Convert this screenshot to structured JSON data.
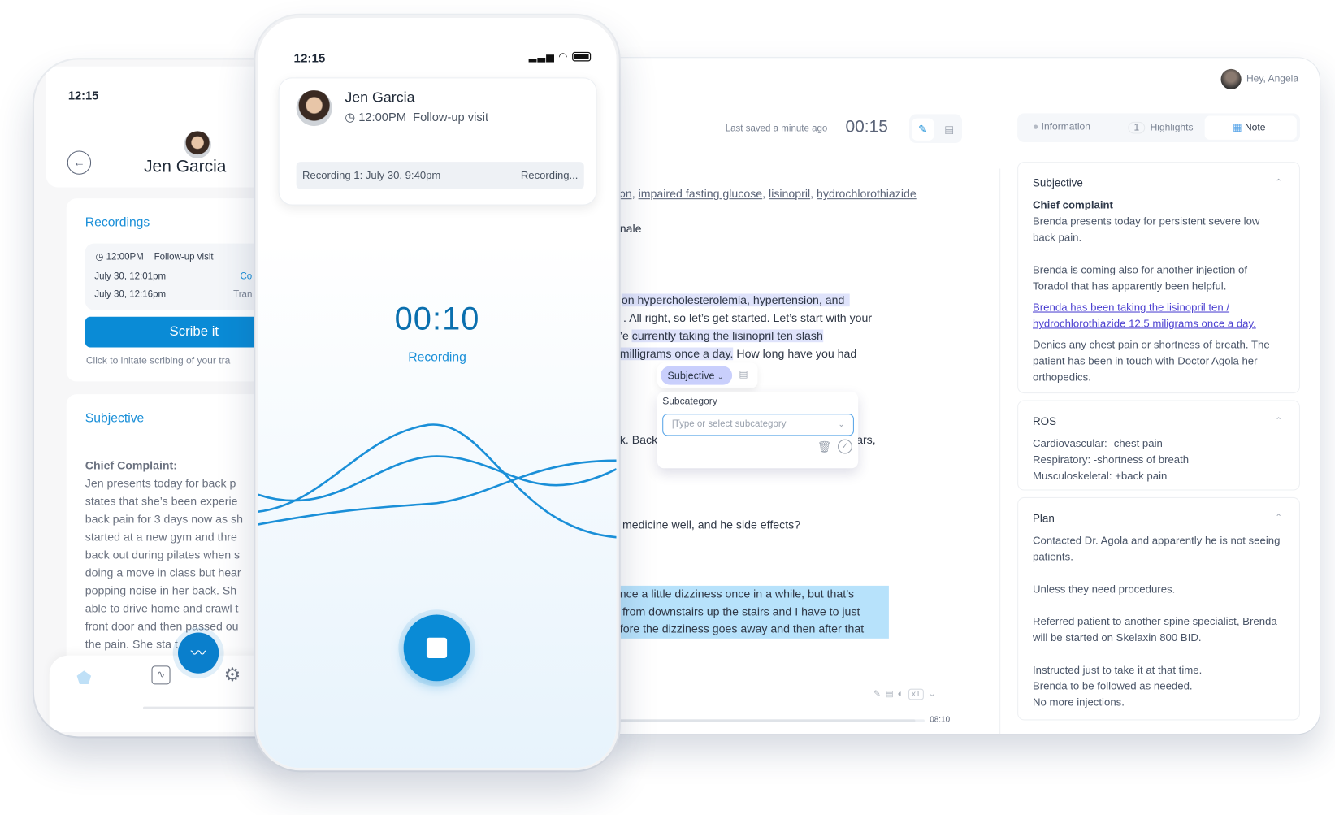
{
  "dashboard": {
    "user_greeting": "Hey, Angela",
    "last_saved": "Last saved a minute ago",
    "timer": "00:15",
    "tabs": [
      {
        "label": "Information",
        "icon": "info-icon"
      },
      {
        "count": "1",
        "label": "Highlights"
      },
      {
        "label": "Note",
        "icon": "note-icon",
        "active": true
      }
    ],
    "transcript": {
      "keywords": [
        "ɔn,",
        "impaired fasting glucose",
        "lisinopril",
        "hydrochlorothiazide"
      ],
      "line_nale": "nale",
      "l1": "on hypercholesterolemia, hypertension, and",
      "l2": ". All right, so let’s get started. Let’s start with your",
      "l3a": "’e ",
      "l3b": "currently taking the lisinopril ten slash",
      "l4a": "milligrams once a day.",
      "l4b": " How long have you had",
      "l5a": "k. Back",
      "l5b": "ars,",
      "l6": "medicine well, and he side effects?",
      "l7": "nce a little dizziness once in a while, but that’s",
      "l8": " from downstairs up the stairs and I have to just",
      "l9": "fore the dizziness goes away and then after that"
    },
    "tag_popup": {
      "category": "Subjective",
      "subcategory_label": "Subcategory",
      "subcategory_placeholder": "Type or select subcategory"
    },
    "player": {
      "speed": "x1",
      "time": "08:10",
      "progress": 0.97
    },
    "note": {
      "subjective": {
        "title": "Subjective",
        "chief_label": "Chief complaint",
        "p1": "Brenda presents today for persistent severe low back pain.",
        "p2": "Brenda is coming also for another injection of Toradol that has apparently been helpful.",
        "p3": "Brenda has been taking the lisinopril ten / hydrochlorothiazide 12.5 miligrams once a day.",
        "p4": "Denies any chest pain or shortness of breath. The patient has been in touch with Doctor Agola her orthopedics."
      },
      "ros": {
        "title": "ROS",
        "lines": [
          "Cardiovascular: -chest pain",
          "Respiratory: -shortness of breath",
          "Musculoskeletal: +back pain"
        ]
      },
      "plan": {
        "title": "Plan",
        "p1": "Contacted Dr. Agola and apparently he is not seeing patients.",
        "p2": "Unless they need procedures.",
        "p3": "Referred patient to another spine specialist, Brenda will be started on Skelaxin 800 BID.",
        "p4": [
          "Instructed just to take it at that time.",
          "Brenda to be followed as needed.",
          "No more injections."
        ]
      }
    }
  },
  "left_phone": {
    "time": "12:15",
    "patient": "Jen Garcia",
    "recordings_title": "Recordings",
    "visit_time": "12:00PM",
    "visit_type": "Follow-up visit",
    "rows": [
      {
        "date": "July 30, 12:01pm",
        "status": "Co"
      },
      {
        "date": "July 30, 12:16pm",
        "status": "Tran"
      }
    ],
    "scribe_button": "Scribe it",
    "scribe_hint": "Click to initate scribing of your tra",
    "subjective_title": "Subjective",
    "chief_label": "Chief Complaint:",
    "chief_lines": [
      "Jen presents today for back p",
      "states that she’s been experie",
      "back pain for 3 days now as sh",
      "started at a new gym and thre",
      "back out during pilates when s",
      "doing a move in class but hear",
      "popping noise in her back. Sh",
      "able to drive home and crawl t",
      "front door and then passed ou",
      "the pain. She sta      t the p"
    ]
  },
  "mid_phone": {
    "time": "12:15",
    "patient": "Jen Garcia",
    "visit_time": "12:00PM",
    "visit_type": "Follow-up visit",
    "recording_label": "Recording 1: July 30, 9:40pm",
    "recording_status": "Recording...",
    "timer": "00:10",
    "state": "Recording"
  },
  "colors": {
    "accent": "#1a8fd8",
    "highlight_purple": "#dfe3fb",
    "highlight_blue": "#b7e2fb",
    "link": "#4a3fd0"
  }
}
